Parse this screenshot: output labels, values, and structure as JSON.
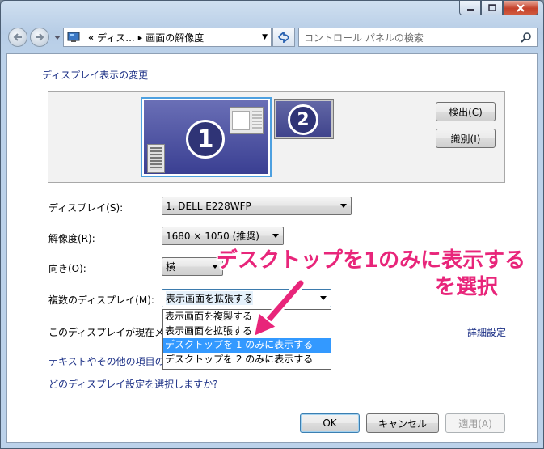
{
  "window": {
    "minimize_icon": "minimize-icon",
    "maximize_icon": "maximize-icon",
    "close_icon": "close-icon"
  },
  "navbar": {
    "breadcrumb_prefix": "«",
    "breadcrumb_1": "ディス...",
    "breadcrumb_sep": "▸",
    "breadcrumb_2": "画面の解像度",
    "search_placeholder": "コントロール パネルの検索"
  },
  "main": {
    "heading": "ディスプレイ表示の変更",
    "monitor1_number": "1",
    "monitor2_number": "2",
    "detect_button": "検出(C)",
    "identify_button": "識別(I)",
    "display_label": "ディスプレイ(S):",
    "display_value": "1. DELL E228WFP",
    "resolution_label": "解像度(R):",
    "resolution_value": "1680 × 1050 (推奨)",
    "orientation_label": "向き(O):",
    "orientation_value": "横",
    "multi_label": "複数のディスプレイ(M):",
    "multi_value": "表示画面を拡張する",
    "multi_options": [
      "表示画面を複製する",
      "表示画面を拡張する",
      "デスクトップを 1 のみに表示する",
      "デスクトップを 2 のみに表示する"
    ],
    "current_display_text": "このディスプレイが現在メ",
    "advanced_link": "詳細設定",
    "text_size_link": "テキストやその他の項目の",
    "which_settings_link": "どのディスプレイ設定を選択しますか?"
  },
  "footer": {
    "ok": "OK",
    "cancel": "キャンセル",
    "apply": "適用(A)"
  },
  "annotation": {
    "line1": "デスクトップを1のみに表示する",
    "line2": "を選択",
    "color": "#e8257a"
  }
}
